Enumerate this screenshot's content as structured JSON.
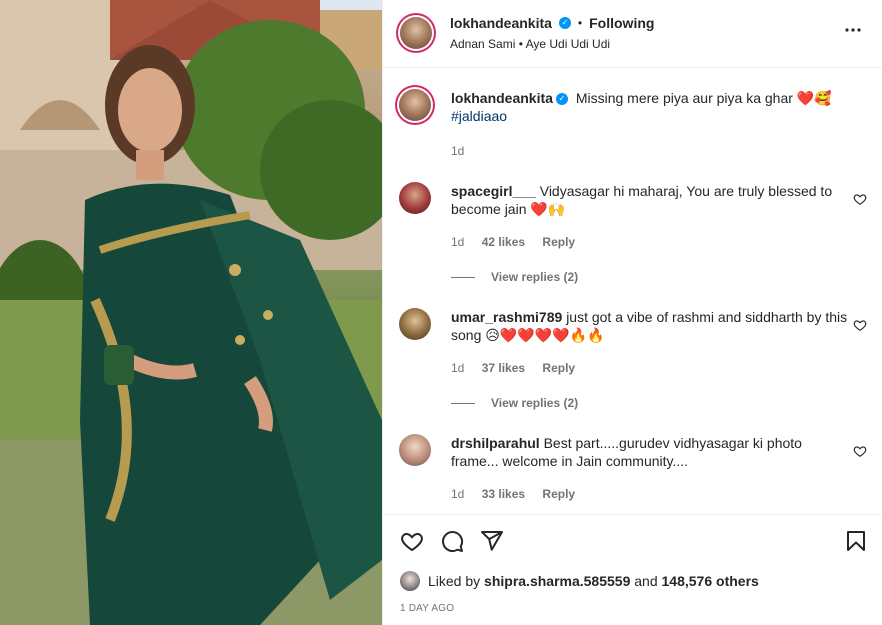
{
  "post": {
    "username": "lokhandeankita",
    "follow_status": "Following",
    "audio": "Adnan Sami • Aye Udi Udi Udi",
    "caption_text": "Missing mere piya aur piya ka ghar ❤️🥰",
    "caption_tag": "#jaldiaao",
    "caption_time": "1d"
  },
  "comments": [
    {
      "username": "spacegirl___",
      "text": "Vidyasagar hi maharaj, You are truly blessed to become jain ❤️🙌",
      "time": "1d",
      "likes": "42 likes",
      "reply_label": "Reply",
      "view_replies": "View replies (2)"
    },
    {
      "username": "umar_rashmi789",
      "text": "just got a vibe of rashmi and siddharth by this song 😥❤️❤️❤️❤️🔥🔥",
      "time": "1d",
      "likes": "37 likes",
      "reply_label": "Reply",
      "view_replies": "View replies (2)"
    },
    {
      "username": "drshilparahul",
      "text": "Best part.....gurudev vidhyasagar ki photo frame... welcome in Jain community....",
      "time": "1d",
      "likes": "33 likes",
      "reply_label": "Reply"
    }
  ],
  "likes": {
    "prefix": "Liked by",
    "user": "shipra.sharma.585559",
    "and": "and",
    "others": "148,576 others"
  },
  "date": "1 DAY AGO",
  "icons": {
    "more": "more-options-icon",
    "like": "heart-icon",
    "comment": "comment-icon",
    "share": "share-icon",
    "save": "bookmark-icon",
    "verified": "verified-badge-icon"
  },
  "colors": {
    "verified": "#0095f6",
    "link": "#00376b",
    "muted": "#737373"
  }
}
